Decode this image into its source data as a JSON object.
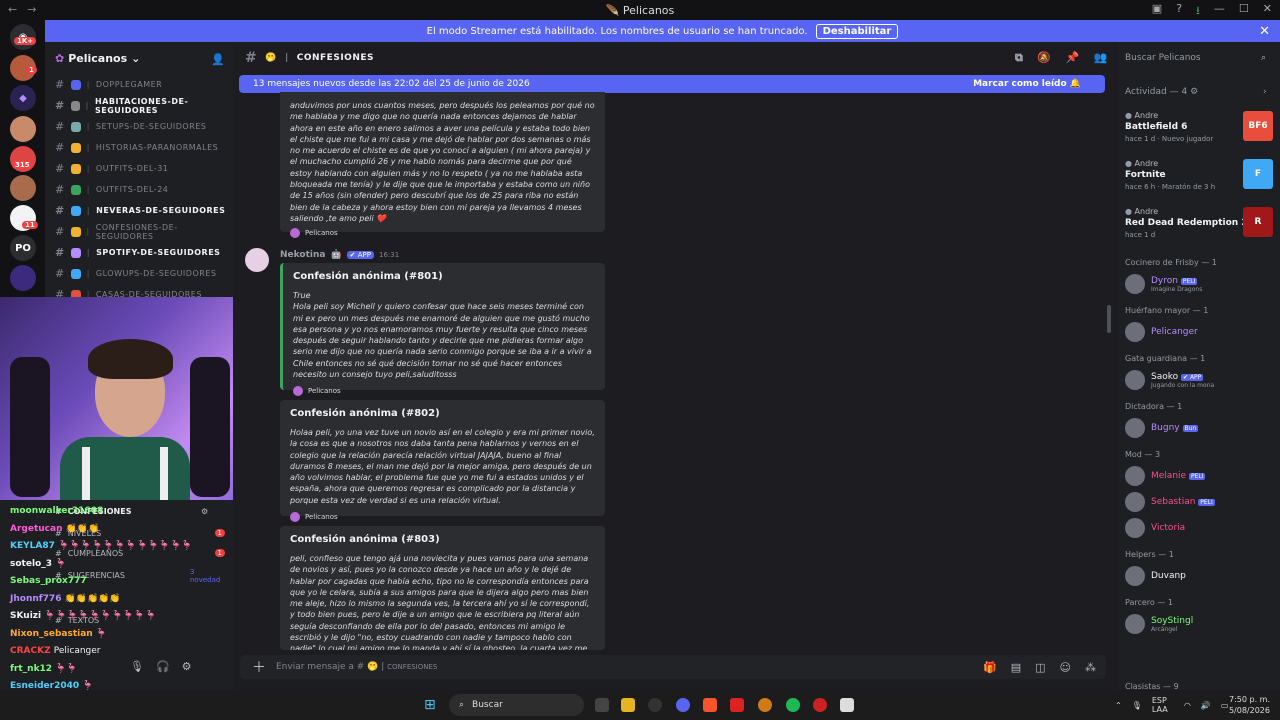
{
  "window": {
    "title": "Pelicanos"
  },
  "streamer": {
    "text": "El modo Streamer está habilitado. Los nombres de usuario se han truncado.",
    "button": "Deshabilitar"
  },
  "rail": {
    "badges": [
      "1K+",
      "1",
      "315",
      "11"
    ],
    "po": "PO"
  },
  "server": {
    "name": "Pelicanos"
  },
  "channels": [
    {
      "name": "DOPPLEGAMER",
      "bold": false,
      "emoji": "🔘"
    },
    {
      "name": "HABITACIONES-DE-SEGUIDORES",
      "bold": true,
      "emoji": "🛏"
    },
    {
      "name": "SETUPS-DE-SEGUIDORES",
      "bold": false,
      "emoji": "🖥"
    },
    {
      "name": "HISTORIAS-PARANORMALES",
      "bold": false,
      "emoji": "😱"
    },
    {
      "name": "OUTFITS-DEL-31",
      "bold": false,
      "emoji": "⭐"
    },
    {
      "name": "OUTFITS-DEL-24",
      "bold": false,
      "emoji": "🎄"
    },
    {
      "name": "NEVERAS-DE-SEGUIDORES",
      "bold": true,
      "emoji": "🧊"
    },
    {
      "name": "CONFESIONES-DE-SEGUIDORES",
      "bold": false,
      "emoji": "🫢"
    },
    {
      "name": "SPOTIFY-DE-SEGUIDORES",
      "bold": true,
      "emoji": "🎵"
    },
    {
      "name": "GLOWUPS-DE-SEGUIDORES",
      "bold": false,
      "emoji": "🖼"
    },
    {
      "name": "CASAS-DE-SEGUIDORES",
      "bold": false,
      "emoji": "🏠"
    }
  ],
  "lower_channels": [
    {
      "name": "CONFESIONES",
      "bold": true
    },
    {
      "name": "NIVELES",
      "bold": false,
      "badge": "1"
    },
    {
      "name": "CUMPLEAÑOS",
      "bold": false,
      "badge": "1"
    },
    {
      "name": "SUGERENCIAS",
      "bold": false,
      "extra": "3 novedad"
    },
    {
      "name": "TEXTOS",
      "bold": false
    }
  ],
  "chat_overlay": [
    {
      "user": "moonwalker31608",
      "color": "#7cfc7c",
      "msg": ""
    },
    {
      "user": "Argetucan",
      "color": "#ff5bd6",
      "msg": "👏👏👏"
    },
    {
      "user": "KEYLA87",
      "color": "#4fd0ff",
      "msg": "🦩🦩🦩🦩🦩🦩🦩🦩🦩🦩🦩🦩"
    },
    {
      "user": "sotelo_3",
      "color": "#f2f3f5",
      "msg": "🦩"
    },
    {
      "user": "Sebas_prox777",
      "color": "#7cfc7c",
      "msg": ""
    },
    {
      "user": "Jhonnf776",
      "color": "#b48cff",
      "msg": "👏👏👏👏👏"
    },
    {
      "user": "SKuizi",
      "color": "#f2f3f5",
      "msg": "🦩🦩🦩🦩🦩🦩🦩🦩🦩🦩"
    },
    {
      "user": "Nixon_sebastian",
      "color": "#ffaa33",
      "msg": "🦩"
    },
    {
      "user": "CRACKZ",
      "color": "#ff4444",
      "msg": "Pelicanger"
    },
    {
      "user": "frt_nk12",
      "color": "#7cfc7c",
      "msg": "🦩🦩"
    },
    {
      "user": "Esneider2040",
      "color": "#4fd0ff",
      "msg": "🦩"
    }
  ],
  "main": {
    "channel": "CONFESIONES",
    "new_messages": "13 mensajes nuevos desde las 22:02 del 25 de junio de 2026",
    "mark_read": "Marcar como leído",
    "prev_text": "anduvimos por unos cuantos meses, pero después los peleamos por qué no me hablaba y me digo que no quería nada entonces dejamos de hablar ahora en este año en enero salimos a aver una película y estaba todo bien el chiste que me fui a mi casa y me dejó de hablar por dos semanas o más no me acuerdo el chiste es de que yo conocí a alguien ( mi ahora pareja) y el muchacho cumplió 26 y me hablo nomás para decirme que por qué estoy hablando con alguien más y no lo respeto ( ya no me hablaba asta bloqueada me tenía) y le dije que que le importaba y estaba como un niño de 15 años (sin ofender) pero descubrí que los de 25 para riba no están bien de la cabeza y ahora estoy bien con mi pareja ya llevamos 4 meses saliendo ,te amo peli ❤️",
    "footer": "Pelicanos",
    "author": "Nekotina",
    "app": "✔ APP",
    "time": "16:31",
    "embeds": [
      {
        "title": "Confesión anónima (#801)",
        "pre": "True",
        "body": "Hola peli soy Michell y quiero confesar que hace seis meses terminé con mi ex pero un mes después me enamoré de alguien que me gustó mucho esa persona y yo nos enamoramos muy fuerte y resulta que cinco meses después de seguir hablando tanto y decirle que me pidieras formar algo serio me dijo que no quería nada serio conmigo porque se iba a ir a vivir a Chile entonces no sé qué decisión tomar no sé qué hacer entonces necesito un consejo tuyo peli,saluditosss"
      },
      {
        "title": "Confesión anónima (#802)",
        "pre": "",
        "body": "Holaa peli, yo una vez tuve un novio así en el colegio y era mi primer novio, la cosa es que a nosotros nos daba tanta pena hablarnos y vernos en el colegio que la relación parecía relación virtual JAJAJA, bueno al final duramos 8 meses, el man me dejó por la mejor amiga, pero después de un año volvimos hablar, el problema fue que yo me fui a estados unidos y el españa, ahora que queremos regresar es complicado por la distancia y porque esta vez de verdad si es una relación virtual."
      },
      {
        "title": "Confesión anónima (#803)",
        "pre": "",
        "body": "peli, confieso que tengo ajá una noviecita y pues vamos para una semana de novios y así, pues yo la conozco desde ya hace un año y le dejé de hablar por cagadas que había echo, tipo no le correspondía entonces para que yo le celara, subía a sus amigos para que le dijera algo pero mas bien me aleje, hizo lo mismo la segunda ves, la tercera ahí yo sí le correspondí, y todo bien pues, pero le dije a un amigo que le escribiera pq literal aún seguía desconfiando de ella por lo del pasado, entonces mi amigo le escribió y le dijo \"no, estoy cuadrando con nadie y tampoco hablo con nadie\" lo cual mi amigo me lo manda y ahí sí la ghosteo, la cuarta vez me escribió solo para decirme que ya estaba con alguien mejor y era"
      }
    ],
    "composer_placeholder": "Enviar mensaje a #",
    "composer_channel": "CONFESIONES"
  },
  "members": {
    "search_placeholder": "Buscar Pelicanos",
    "activity_title": "Actividad — 4",
    "games": [
      {
        "user": "Andre",
        "game": "Battlefield 6",
        "sub": "hace 1 d · Nuevo jugador",
        "cover": "#e94e3c",
        "label": "BF6"
      },
      {
        "user": "Andre",
        "game": "Fortnite",
        "sub": "hace 6 h · Maratón de 3 h",
        "cover": "#3fa9f5",
        "label": "F"
      },
      {
        "user": "Andre",
        "game": "Red Dead Redemption 2",
        "sub": "hace 1 d",
        "cover": "#a01818",
        "label": "R"
      }
    ],
    "groups": [
      {
        "role": "Cocinero de Frisby — 1",
        "members": [
          {
            "name": "Dyron",
            "tag": "PELI",
            "sub": "Imagine Dragons",
            "color": "#b48cff"
          }
        ]
      },
      {
        "role": "Huérfano mayor — 1",
        "members": [
          {
            "name": "Pelicanger",
            "tag": "",
            "sub": "",
            "color": "#b48cff"
          }
        ]
      },
      {
        "role": "Gata guardiana — 1",
        "members": [
          {
            "name": "Saoko",
            "tag": "✔ APP",
            "sub": "Jugando con la mona",
            "color": "#f2f3f5"
          }
        ]
      },
      {
        "role": "Dictadora — 1",
        "members": [
          {
            "name": "Bugny",
            "tag": "Bun",
            "sub": "",
            "color": "#b48cff"
          }
        ]
      },
      {
        "role": "Mod — 3",
        "members": [
          {
            "name": "Melanie",
            "tag": "PELI",
            "sub": "",
            "color": "#ff4d8d"
          },
          {
            "name": "Sebastian",
            "tag": "PELI",
            "sub": "",
            "color": "#ff4d8d"
          },
          {
            "name": "Victoria",
            "tag": "",
            "sub": "",
            "color": "#ff4d8d"
          }
        ]
      },
      {
        "role": "Helpers — 1",
        "members": [
          {
            "name": "Duvanp",
            "tag": "",
            "sub": "",
            "color": "#f2f3f5"
          }
        ]
      },
      {
        "role": "Parcero — 1",
        "members": [
          {
            "name": "SoyStingl",
            "tag": "",
            "sub": "Arcángel",
            "color": "#7cfc7c"
          }
        ]
      }
    ],
    "last_role": "Clasistas — 9"
  },
  "taskbar": {
    "search": "Buscar",
    "lang": "ESP LAA",
    "time": "7:50 p. m.",
    "date": "5/08/2026"
  }
}
